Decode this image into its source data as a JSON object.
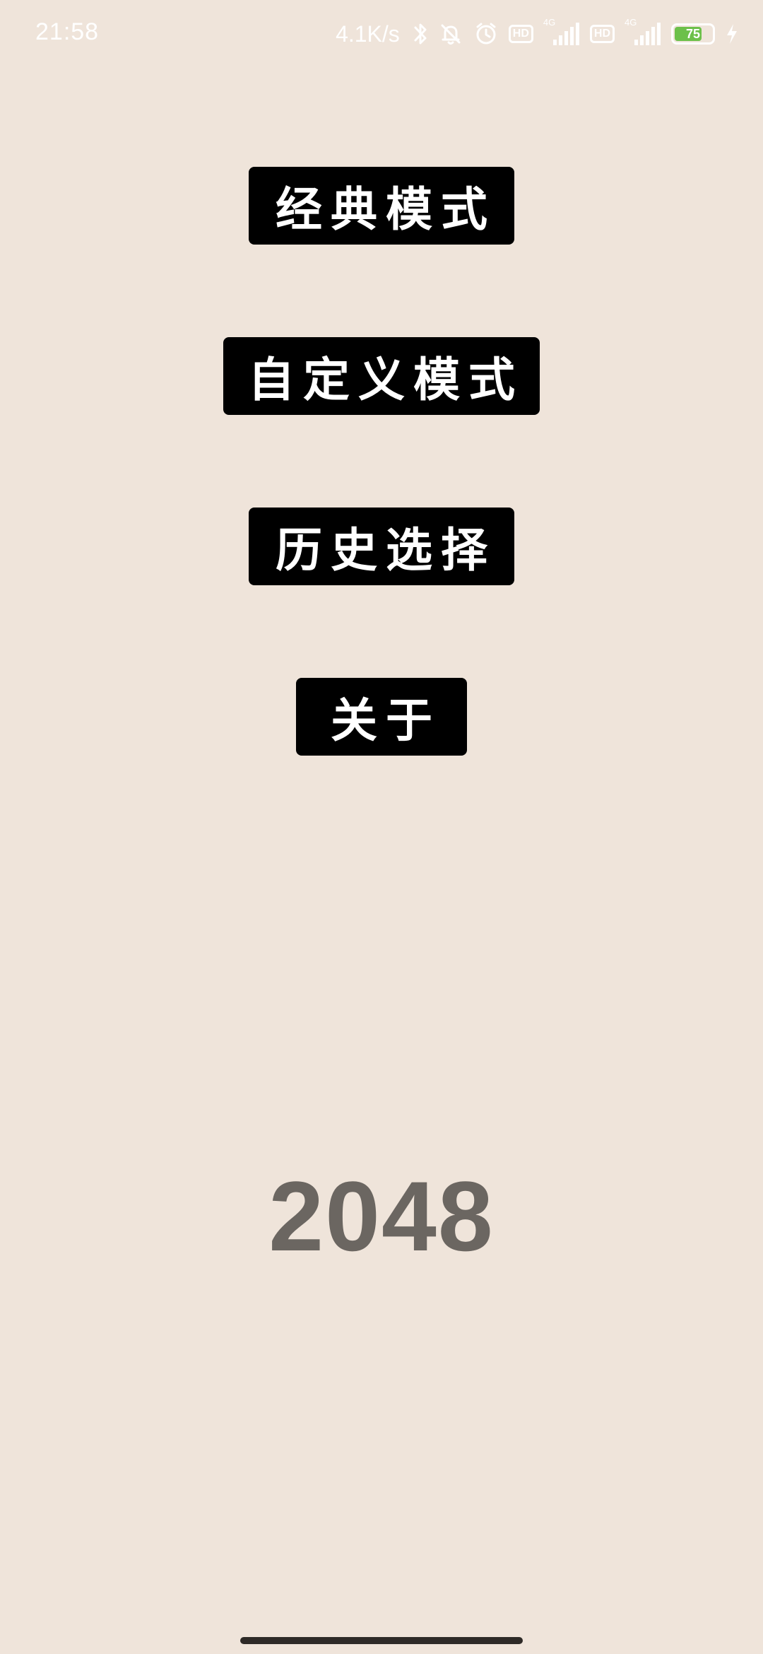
{
  "status_bar": {
    "time": "21:58",
    "net_speed": "4.1K/s",
    "hd_label": "HD",
    "network_label": "4G",
    "battery_level": "75",
    "icons": [
      "bluetooth-icon",
      "bell-off-icon",
      "alarm-icon",
      "hd-icon",
      "signal-icon",
      "battery-icon",
      "charging-icon"
    ],
    "battery_color": "#6CC04A"
  },
  "menu": {
    "classic_mode": "经典模式",
    "custom_mode": "自定义模式",
    "history": "历史选择",
    "about": "关于"
  },
  "title": "2048",
  "colors": {
    "background": "#EFE4DA",
    "button": "#000000",
    "button_text": "#FFFFFF",
    "title_text": "#6B6661"
  }
}
